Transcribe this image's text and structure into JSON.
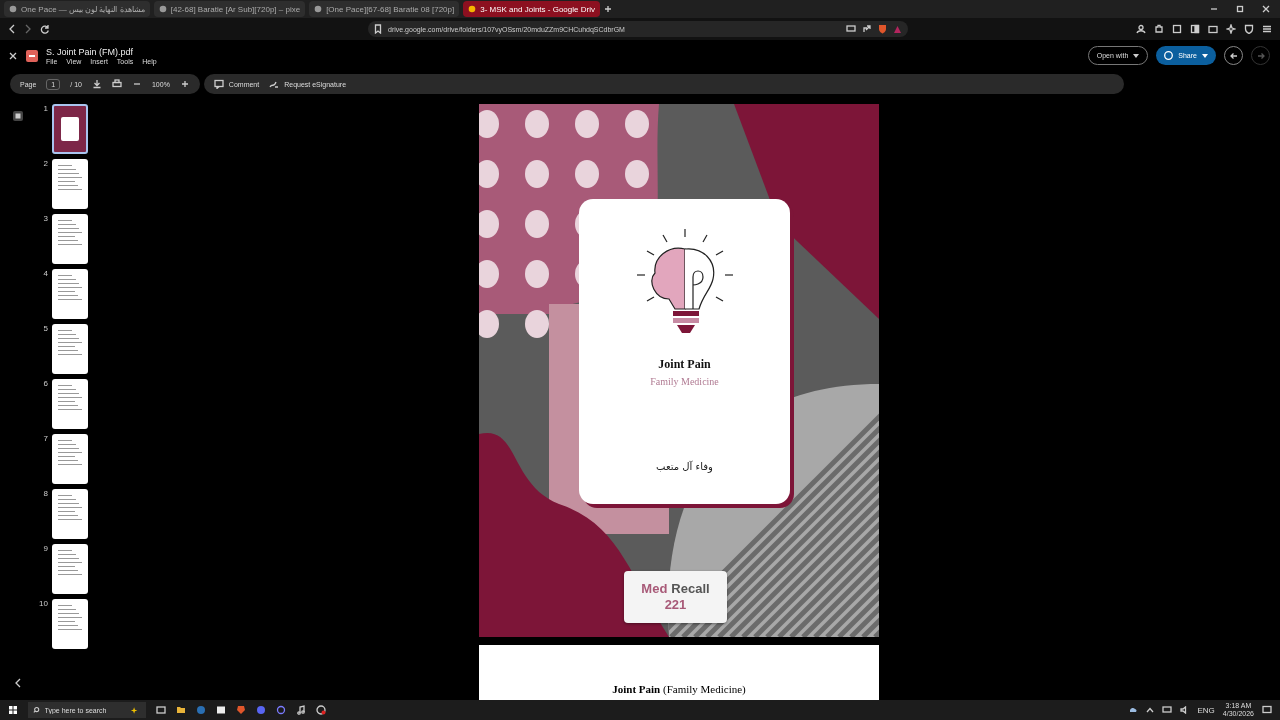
{
  "browser": {
    "tabs": [
      {
        "title": "One Pace — مشاهدة النهاية لون بيس",
        "selected": false
      },
      {
        "title": "[42-68] Baratie [Ar Sub][720p] – pixe",
        "selected": false
      },
      {
        "title": "[One Pace][67-68] Baratie 08 [720p]",
        "selected": false
      },
      {
        "title": "3- MSK and Joints - Google Driv",
        "selected": true
      }
    ],
    "url": "drive.google.com/drive/folders/107vyOSsm/20mduZZm9CHCuhdqSCdbrGM"
  },
  "viewer": {
    "file_name": "S. Joint Pain (FM).pdf",
    "menu": [
      "File",
      "View",
      "Insert",
      "Tools",
      "Help"
    ],
    "page_label": "Page",
    "page_value": "1",
    "page_total": "/ 10",
    "zoom": "100%",
    "comment": "Comment",
    "request": "Request eSignature",
    "open_with": "Open with",
    "share": "Share"
  },
  "thumbnails": [
    {
      "number": "1",
      "kind": "cover",
      "selected": true
    },
    {
      "number": "2",
      "kind": "text",
      "selected": false
    },
    {
      "number": "3",
      "kind": "text",
      "selected": false
    },
    {
      "number": "4",
      "kind": "text",
      "selected": false
    },
    {
      "number": "5",
      "kind": "text",
      "selected": false
    },
    {
      "number": "6",
      "kind": "text",
      "selected": false
    },
    {
      "number": "7",
      "kind": "text",
      "selected": false
    },
    {
      "number": "8",
      "kind": "text",
      "selected": false
    },
    {
      "number": "9",
      "kind": "text",
      "selected": false
    },
    {
      "number": "10",
      "kind": "text",
      "selected": false
    }
  ],
  "cover": {
    "title": "Joint Pain",
    "subtitle": "Family Medicine",
    "author": "وفاء آل متعب",
    "brand": [
      "Med",
      "Recall"
    ],
    "brand_number": "221"
  },
  "next_page": {
    "heading": "**Joint Pain** (Family Medicine)"
  },
  "taskbar": {
    "search_placeholder": "Type here to search",
    "language": "ENG",
    "time": "3:18 AM",
    "date": "4/30/2026"
  }
}
